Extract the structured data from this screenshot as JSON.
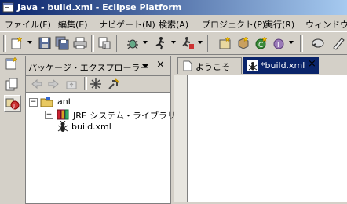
{
  "window": {
    "title": "Java - build.xml - Eclipse Platform"
  },
  "menu": [
    "ファイル(F)",
    "編集(E)",
    "ナビゲート(N)",
    "検索(A)",
    "プロジェクト(P)",
    "実行(R)",
    "ウィンドウ("
  ],
  "explorer": {
    "title": "パッケージ・エクスプローラー",
    "close": "×",
    "tree": [
      {
        "label": "ant",
        "expander": "−"
      },
      {
        "label": "JRE システム・ライブラリー [",
        "expander": "+"
      },
      {
        "label": "build.xml"
      }
    ]
  },
  "editor": {
    "tabs": [
      {
        "label": "ようこそ"
      },
      {
        "label": "*build.xml",
        "close": "×"
      }
    ]
  }
}
